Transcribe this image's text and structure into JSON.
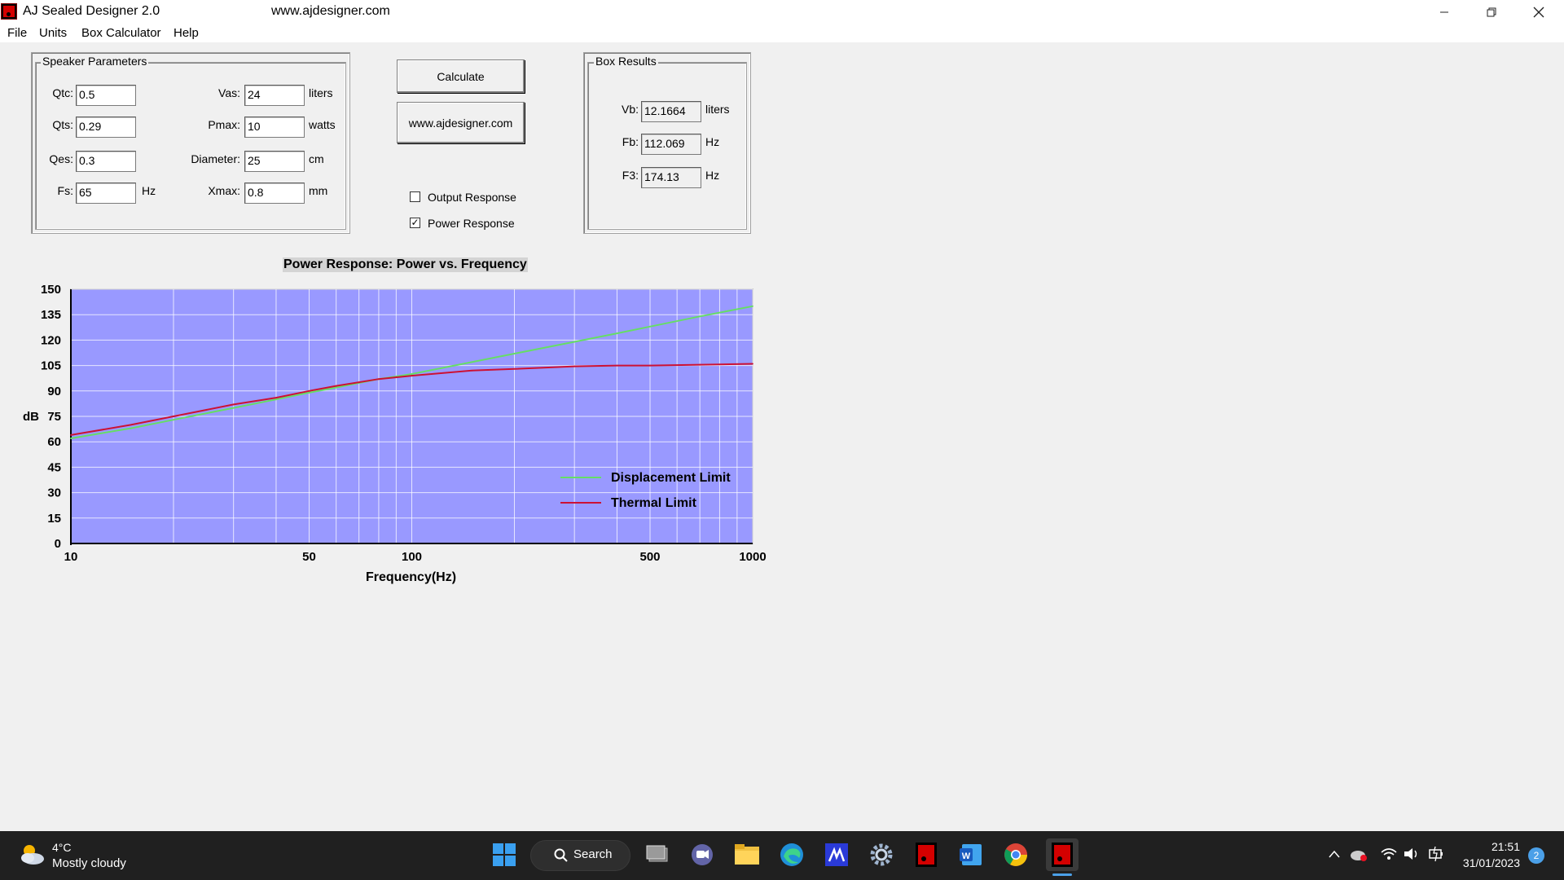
{
  "window": {
    "title": "AJ Sealed Designer 2.0",
    "url": "www.ajdesigner.com"
  },
  "menu": {
    "items": [
      "File",
      "Units",
      "Box Calculator",
      "Help"
    ]
  },
  "speaker_parameters": {
    "group_label": "Speaker Parameters",
    "qtc": {
      "label": "Qtc:",
      "value": "0.5"
    },
    "qts": {
      "label": "Qts:",
      "value": "0.29"
    },
    "qes": {
      "label": "Qes:",
      "value": "0.3"
    },
    "fs": {
      "label": "Fs:",
      "value": "65",
      "unit": "Hz"
    },
    "vas": {
      "label": "Vas:",
      "value": "24",
      "unit": "liters"
    },
    "pmax": {
      "label": "Pmax:",
      "value": "10",
      "unit": "watts"
    },
    "diameter": {
      "label": "Diameter:",
      "value": "25",
      "unit": "cm"
    },
    "xmax": {
      "label": "Xmax:",
      "value": "0.8",
      "unit": "mm"
    }
  },
  "actions": {
    "calculate": "Calculate",
    "website": "www.ajdesigner.com",
    "output_response": {
      "label": "Output Response",
      "checked": false
    },
    "power_response": {
      "label": "Power Response",
      "checked": true
    }
  },
  "box_results": {
    "group_label": "Box Results",
    "vb": {
      "label": "Vb:",
      "value": "12.1664",
      "unit": "liters"
    },
    "fb": {
      "label": "Fb:",
      "value": "112.069",
      "unit": "Hz"
    },
    "f3": {
      "label": "F3:",
      "value": "174.13",
      "unit": "Hz"
    }
  },
  "chart_data": {
    "type": "line",
    "title": "Power Response: Power vs. Frequency",
    "xlabel": "Frequency(Hz)",
    "ylabel": "dB",
    "x_scale": "log",
    "xlim": [
      10,
      1000
    ],
    "ylim": [
      0,
      150
    ],
    "x_ticks": [
      10,
      50,
      100,
      500,
      1000
    ],
    "y_ticks": [
      0,
      15,
      30,
      45,
      60,
      75,
      90,
      105,
      120,
      135,
      150
    ],
    "grid": true,
    "legend_position": "bottom-right",
    "background_color": "#9999ff",
    "series": [
      {
        "name": "Displacement Limit",
        "color": "#66dd66",
        "x": [
          10,
          15,
          20,
          30,
          40,
          50,
          60,
          80,
          100,
          150,
          200,
          300,
          400,
          500,
          700,
          1000
        ],
        "values": [
          62,
          68,
          73,
          80,
          85,
          89,
          92,
          97,
          100,
          107,
          112,
          119,
          124,
          128,
          134,
          140
        ]
      },
      {
        "name": "Thermal Limit",
        "color": "#cc1133",
        "x": [
          10,
          15,
          20,
          30,
          40,
          50,
          60,
          80,
          100,
          150,
          200,
          300,
          400,
          500,
          700,
          1000
        ],
        "values": [
          64,
          70,
          75,
          82,
          86,
          90,
          93,
          97,
          99,
          102,
          103,
          104.5,
          105,
          105,
          105.5,
          106
        ]
      }
    ]
  },
  "taskbar": {
    "weather_temp": "4°C",
    "weather_desc": "Mostly cloudy",
    "search_label": "Search",
    "clock_time": "21:51",
    "clock_date": "31/01/2023",
    "notification_count": "2"
  }
}
